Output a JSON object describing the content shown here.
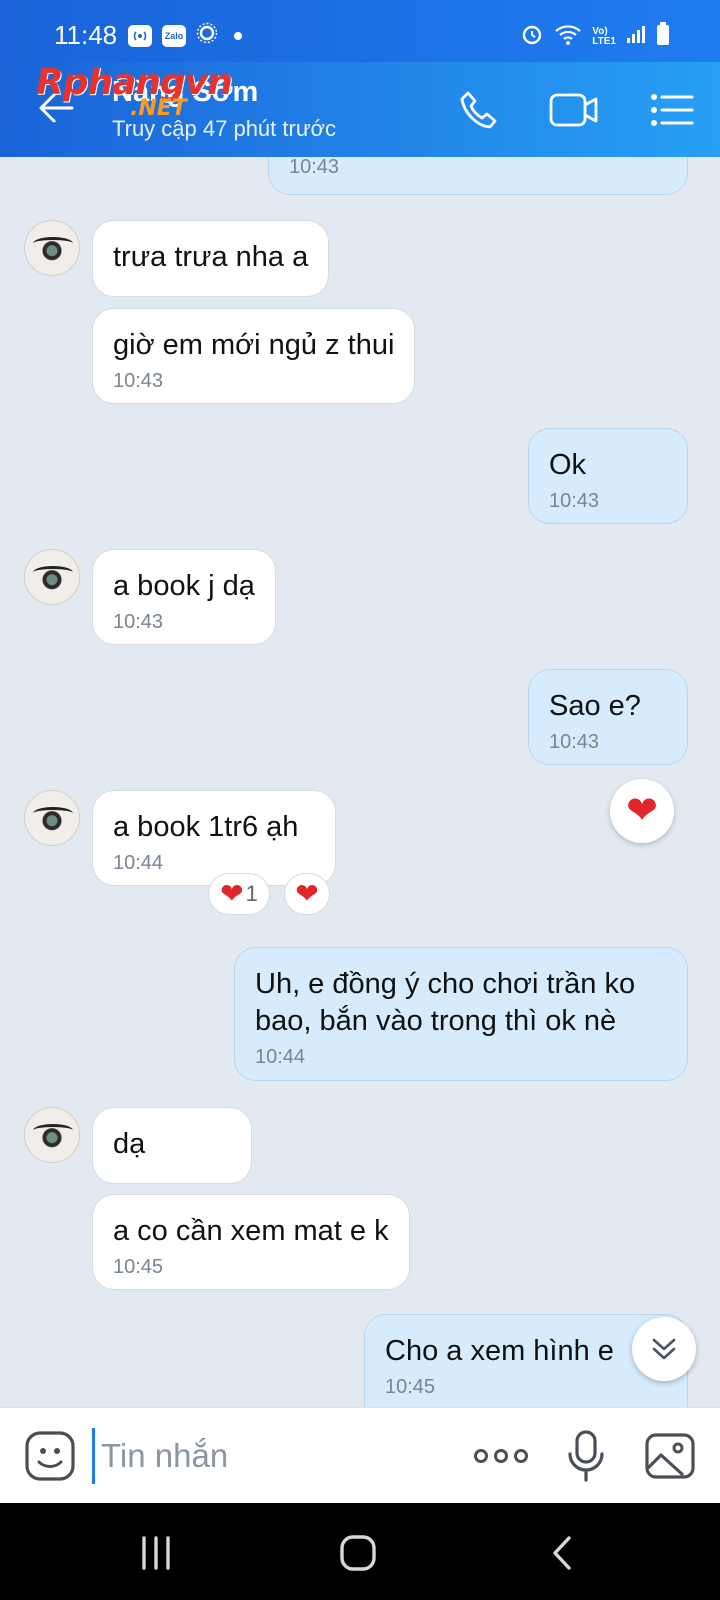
{
  "status_bar": {
    "time": "11:48",
    "app_badge": "Zalo",
    "network_label_top": "Vo)",
    "network_label_bottom": "LTE1"
  },
  "header": {
    "contact_name": "Nắng Sớm",
    "status": "Truy cập 47 phút trước",
    "watermark_main": "Rphangvn",
    "watermark_suffix": ".NET",
    "icons": [
      "back-arrow-icon",
      "phone-icon",
      "video-call-icon",
      "menu-list-icon"
    ]
  },
  "messages": [
    {
      "dir": "out",
      "text": "",
      "time": "10:43"
    },
    {
      "dir": "in",
      "text": "trưa trưa nha a",
      "time": ""
    },
    {
      "dir": "in",
      "text": "giờ em mới ngủ z thui",
      "time": "10:43"
    },
    {
      "dir": "out",
      "text": "Ok",
      "time": "10:43"
    },
    {
      "dir": "in",
      "text": "a book j dạ",
      "time": "10:43"
    },
    {
      "dir": "out",
      "text": "Sao e?",
      "time": "10:43"
    },
    {
      "dir": "in",
      "text": "a book 1tr6 ạh",
      "time": "10:44",
      "reaction_count": "1"
    },
    {
      "dir": "out",
      "text": "Uh, e đồng ý cho chơi trần ko bao, bắn vào trong thì ok nè",
      "time": "10:44"
    },
    {
      "dir": "in",
      "text": "dạ",
      "time": ""
    },
    {
      "dir": "in",
      "text": "a co cần xem mat e k",
      "time": "10:45"
    },
    {
      "dir": "out",
      "text": "Cho a xem hình e",
      "time": "10:45"
    }
  ],
  "input": {
    "placeholder": "Tin nhắn"
  },
  "colors": {
    "header_gradient_start": "#1a63d8",
    "header_gradient_end": "#27a0f5",
    "chat_background": "#e2e9f1",
    "incoming_bubble": "#ffffff",
    "outgoing_bubble": "#d6ecfc",
    "heart": "#e0262b"
  }
}
